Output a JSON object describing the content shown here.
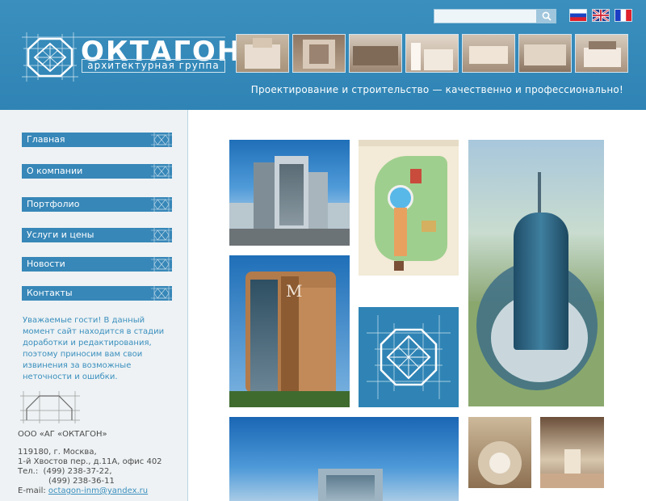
{
  "header": {
    "brand_title": "ОКТАГОН",
    "brand_subtitle": "архитектурная группа",
    "tagline": "Проектирование и строительство — качественно и профессионально!",
    "search": {
      "placeholder": "",
      "value": ""
    },
    "languages": [
      "ru",
      "en",
      "fr"
    ]
  },
  "nav": {
    "items": [
      {
        "label": "Главная"
      },
      {
        "label": "О компании"
      },
      {
        "label": "Портфолио"
      },
      {
        "label": "Услуги и цены"
      },
      {
        "label": "Новости"
      },
      {
        "label": "Контакты"
      }
    ]
  },
  "notice": "Уважаемые гости! В данный момент сайт находится в стадии доработки и редактирования, поэтому приносим вам свои извинения за возможные неточности и ошибки.",
  "contact": {
    "company": "ООО «АГ «ОКТАГОН»",
    "address1": "119180, г. Москва,",
    "address2": "1-й Хвостов пер., д.11А, офис 402",
    "phone1": "Тел.:  (499) 238-37-22,",
    "phone2": "(499) 238-36-11",
    "email_label": "E-mail:",
    "email": "octagon-inm@yandex.ru"
  },
  "colors": {
    "header": "#3a8fbe",
    "nav": "#3787b8",
    "sidebar": "#eef2f4"
  }
}
